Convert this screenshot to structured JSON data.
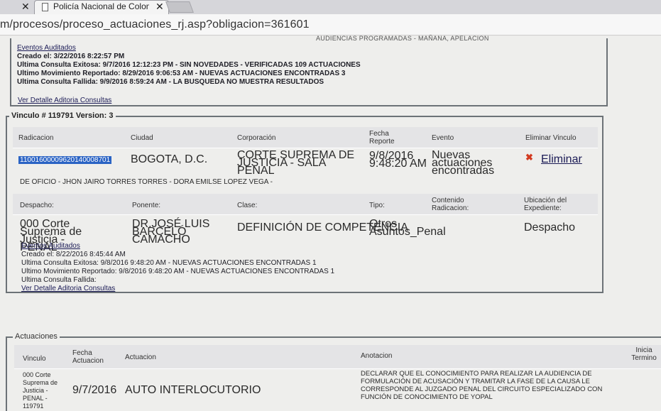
{
  "browser": {
    "tab_title": "Policía Nacional de Colom",
    "close_glyph": "✕",
    "url": "m/procesos/proceso_actuaciones_rj.asp?obligacion=361601"
  },
  "partial_header": "AUDIENCIAS PROGRAMADAS - MAÑANA, APELACION",
  "top_audit": {
    "title": "Eventos Auditados",
    "lines": [
      "Creado el: 3/22/2016 8:22:57 PM",
      "Ultima Consulta Exitosa: 9/7/2016 12:12:23 PM - SIN NOVEDADES - VERIFICADAS 109 ACTUACIONES",
      "Ultimo Movimiento Reportado: 8/29/2016 9:06:53 AM - NUEVAS ACTUACIONES ENCONTRADAS 3",
      "Ultima Consulta Fallida: 9/9/2016 8:59:24 AM - LA BUSQUEDA NO MUESTRA RESULTADOS"
    ],
    "detail_link": "Ver Detalle Aditoria Consultas"
  },
  "vinculo": {
    "legend": "Vinculo # 119791 Version: 3",
    "headers": {
      "radicacion": "Radicacion",
      "ciudad": "Ciudad",
      "corporacion": "Corporación",
      "fecha_reporte": "Fecha Reporte",
      "evento": "Evento",
      "eliminar": "Eliminar Vinculo"
    },
    "row": {
      "radicacion": "11001600009620140008701",
      "ciudad": "BOGOTA, D.C.",
      "corporacion": "CORTE SUPREMA DE JUSTICIA - SALA PENAL",
      "fecha_reporte_date": "9/8/2016",
      "fecha_reporte_time": "9:48:20 AM",
      "evento": "Nuevas actuaciones encontradas",
      "eliminar_label": "Eliminar",
      "eliminar_icon": "delete-x-icon"
    },
    "parties": "DE OFICIO - JHON JAIRO TORRES TORRES - DORA EMILSE LOPEZ VEGA -",
    "headers2": {
      "despacho": "Despacho:",
      "ponente": "Ponente:",
      "clase": "Clase:",
      "tipo": "Tipo:",
      "contenido": "Contenido Radicacion:",
      "ubicacion": "Ubicación del Expediente:"
    },
    "row2": {
      "despacho": "000 Corte Suprema de Justicia - PENAL",
      "ponente": "DR.JOSÉ LUIS BARCELÓ CAMACHO",
      "clase": "DEFINICIÓN DE COMPETENCIA",
      "tipo": "Otros Asuntos_Penal",
      "contenido": "",
      "ubicacion": "Despacho"
    },
    "audit": {
      "title": "Eventos Auditados",
      "lines": [
        "Creado el: 8/22/2016 8:45:44 AM",
        "Ultima Consulta Exitosa: 9/8/2016 9:48:20 AM - NUEVAS ACTUACIONES ENCONTRADAS 1",
        "Ultimo Movimiento Reportado: 9/8/2016 9:48:20 AM - NUEVAS ACTUACIONES ENCONTRADAS 1",
        "Ultima Consulta Fallida:"
      ],
      "detail_link": "Ver Detalle Aditoria Consultas"
    }
  },
  "actuaciones": {
    "legend": "Actuaciones",
    "headers": {
      "vinculo": "Vinculo",
      "fecha": "Fecha Actuacion",
      "actuacion": "Actuacion",
      "anotacion": "Anotacion",
      "inicia": "Inicia Termino"
    },
    "row": {
      "vinculo": "000 Corte Suprema de Justicia - PENAL - 119791",
      "fecha": "9/7/2016",
      "actuacion": "AUTO INTERLOCUTORIO",
      "anotacion": "DECLARAR QUE EL CONOCIMIENTO PARA REALIZAR LA AUDIENCIA DE FORMULACIÓN DE ACUSACIÓN Y TRAMITAR LA FASE DE LA CAUSA LE CORRESPONDE AL JUZGADO PENAL DEL CIRCUITO ESPECIALIZADO CON FUNCIÓN DE CONOCIMIENTO DE YOPAL"
    }
  }
}
